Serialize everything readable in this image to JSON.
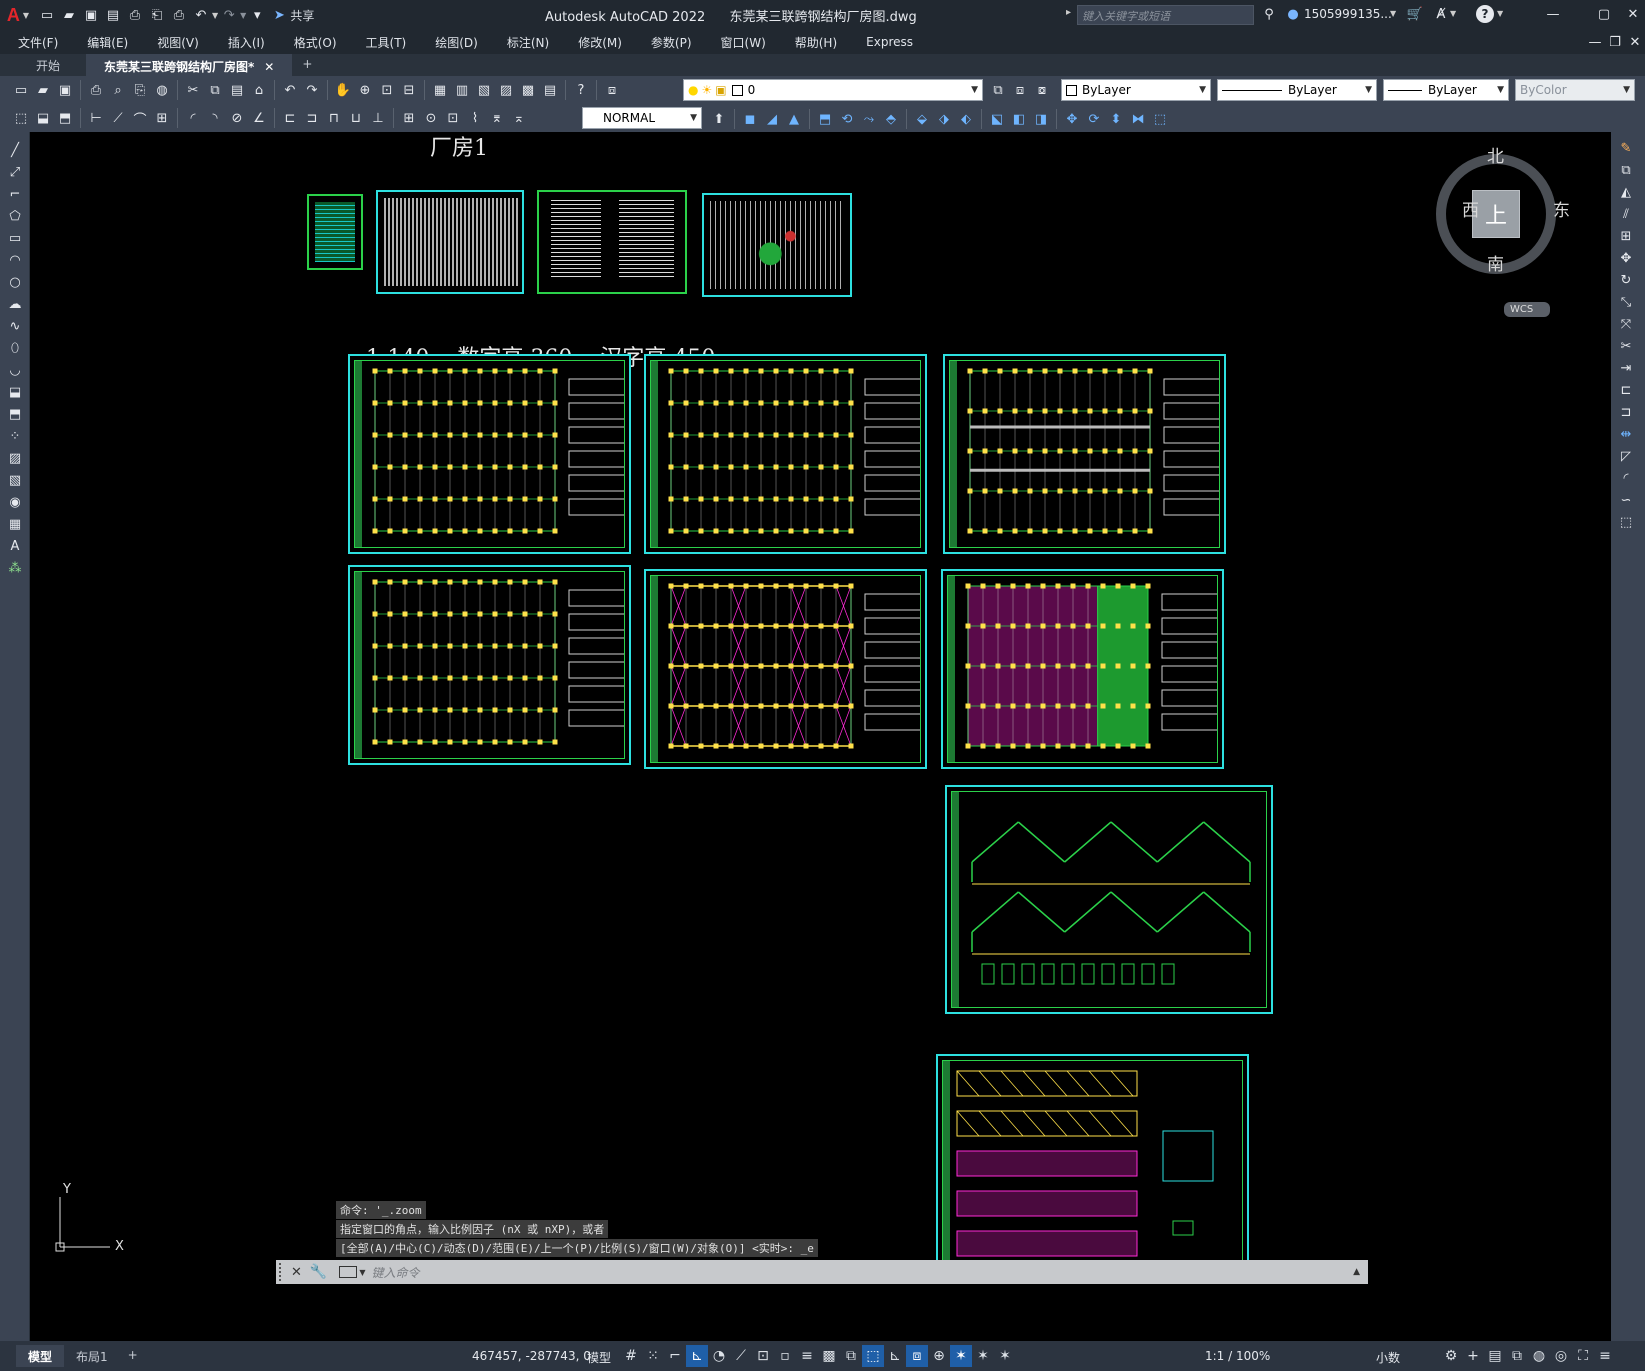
{
  "app": {
    "title": "Autodesk AutoCAD 2022",
    "filename": "东莞某三联跨钢结构厂房图.dwg",
    "share_label": "共享",
    "search_placeholder": "键入关键字或短语",
    "user": "1505999135...",
    "logo_letter": "A"
  },
  "menu": [
    "文件(F)",
    "编辑(E)",
    "视图(V)",
    "插入(I)",
    "格式(O)",
    "工具(T)",
    "绘图(D)",
    "标注(N)",
    "修改(M)",
    "参数(P)",
    "窗口(W)",
    "帮助(H)",
    "Express"
  ],
  "tabs": {
    "start": "开始",
    "drawing": "东莞某三联跨钢结构厂房图*",
    "add": "+"
  },
  "toolbar": {
    "layer_value": "0",
    "color_value": "ByLayer",
    "linetype_value": "ByLayer",
    "lineweight_value": "ByLayer",
    "plotstyle_value": "ByColor",
    "dimstyle_value": "NORMAL"
  },
  "viewcube": {
    "north": "北",
    "south": "南",
    "east": "东",
    "west": "西",
    "face": "上",
    "wcs": "WCS"
  },
  "drawing": {
    "title1": "厂房1",
    "scale_note": "1:140    数字高 360    汉字高 450"
  },
  "ucs": {
    "x": "X",
    "y": "Y"
  },
  "command": {
    "line1": "命令: '_.zoom",
    "line2": "指定窗口的角点，输入比例因子 (nX 或 nXP)，或者",
    "line3": "[全部(A)/中心(C)/动态(D)/范围(E)/上一个(P)/比例(S)/窗口(W)/对象(O)] <实时>: _e",
    "placeholder": "键入命令"
  },
  "layout_tabs": [
    "模型",
    "布局1",
    "+"
  ],
  "status": {
    "coords": "467457, -287743, 0",
    "model": "模型",
    "scale": "1:1 / 100%",
    "units": "小数"
  },
  "colors": {
    "chrome": "#3b4453",
    "titlebar": "#212830",
    "sheet_border": "#2de0e0",
    "sheet_inner": "#2bd14a",
    "active_status": "#1f5fa8"
  }
}
